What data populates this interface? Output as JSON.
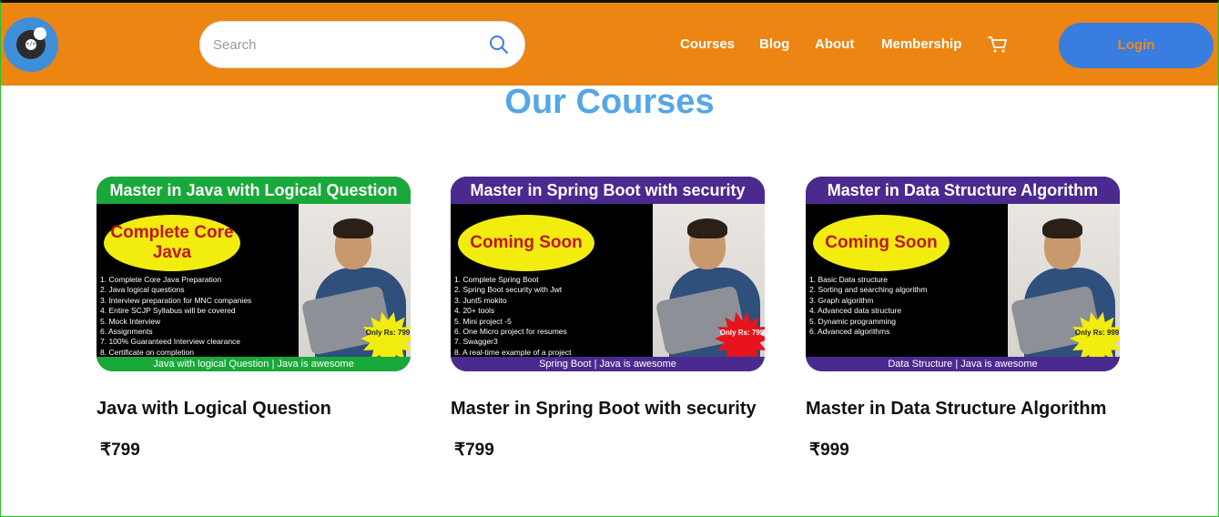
{
  "header": {
    "search_placeholder": "Search",
    "nav": [
      "Courses",
      "Blog",
      "About",
      "Membership"
    ],
    "login_label": "Login",
    "colors": {
      "bar": "#ec8511",
      "login_bg": "#3a7de0",
      "login_text": "#f08a1a"
    }
  },
  "page": {
    "title": "Our Courses",
    "title_color": "#55a7e6"
  },
  "courses": [
    {
      "banner_title": "Master in Java with Logical Question",
      "banner_color": "#19a83a",
      "ellipse_text": "Complete Core Java",
      "bullets": [
        "1. Complete Core Java Preparation",
        "2. Java logical questions",
        "3. Interview preparation for MNC companies",
        "4. Entire SCJP Syllabus will be covered",
        "5. Mock Interview",
        "6. Assignments",
        "7. 100% Guaranteed Interview clearance",
        "8. Certificate on completion"
      ],
      "burst_text": "Only Rs: 799",
      "burst_color": "#f3ec0f",
      "burst_text_color": "#222222",
      "footer": "Java with logical Question | Java is awesome",
      "title": "Java with Logical Question",
      "price": "₹799"
    },
    {
      "banner_title": "Master in Spring Boot with security",
      "banner_color": "#4b2a8f",
      "ellipse_text": "Coming Soon",
      "bullets": [
        "1. Complete Spring Boot",
        "2. Spring Boot security with Jwt",
        "3. Junt5 mokito",
        "4. 20+ tools",
        "5. Mini project -5",
        "6. One Micro project for resumes",
        "7. Swagger3",
        "8. A real-time example of a project"
      ],
      "burst_text": "Only Rs: 799",
      "burst_color": "#e8141c",
      "burst_text_color": "#ffffff",
      "footer": "Spring Boot | Java is awesome",
      "title": "Master in Spring Boot with security",
      "price": "₹799"
    },
    {
      "banner_title": "Master in Data Structure Algorithm",
      "banner_color": "#4b2a8f",
      "ellipse_text": "Coming Soon",
      "bullets": [
        "1. Basic Data structure",
        "2. Sorting and searching algorithm",
        "3. Graph algorithm",
        "4. Advanced data structure",
        "5. Dynamic programming",
        "6. Advanced algorithms"
      ],
      "burst_text": "Only Rs: 999",
      "burst_color": "#f3ec0f",
      "burst_text_color": "#222222",
      "footer": "Data Structure | Java is awesome",
      "title": "Master in Data Structure Algorithm",
      "price": "₹999"
    }
  ]
}
